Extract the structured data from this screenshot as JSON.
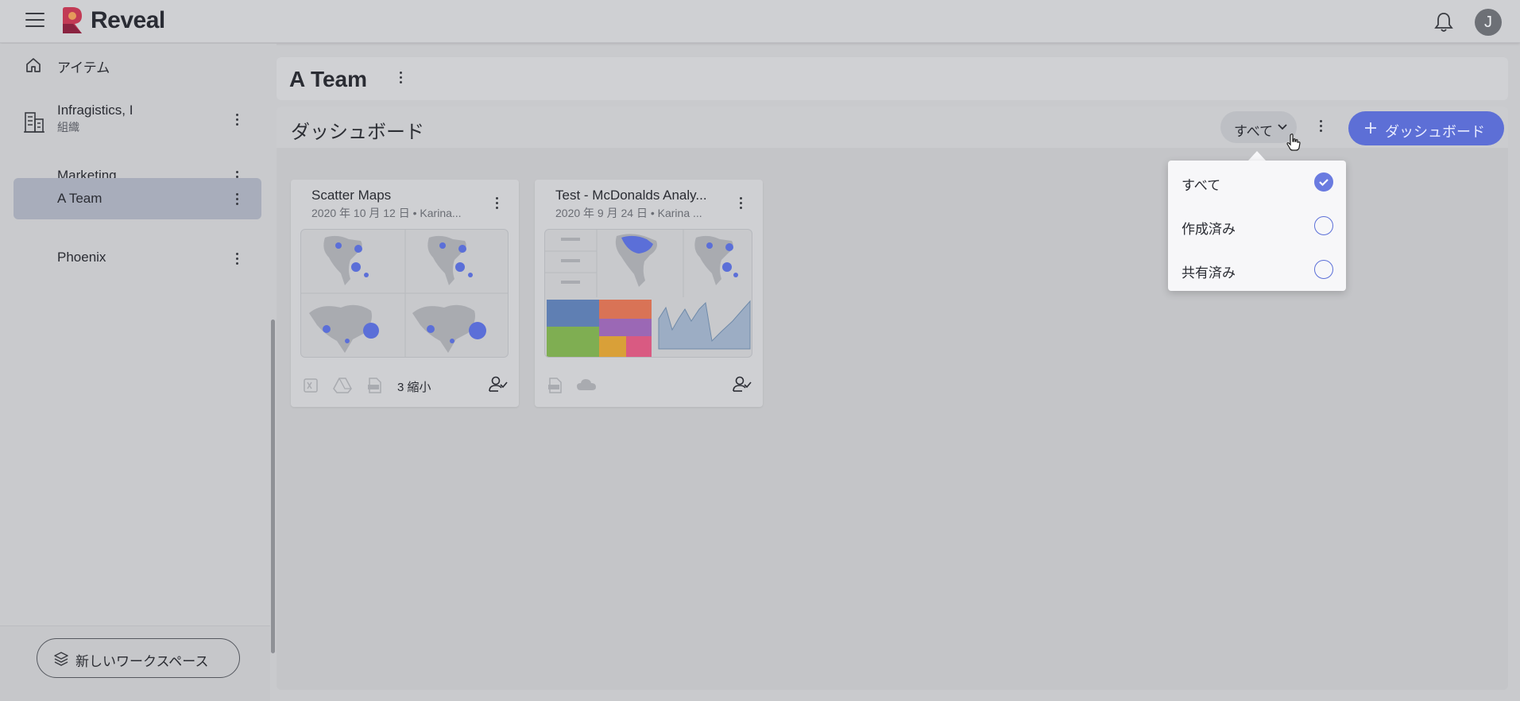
{
  "app": {
    "brand": "Reveal",
    "user_initial": "J",
    "accent_color": "#5d6fd6"
  },
  "sidebar": {
    "items": [
      {
        "label": "アイテム",
        "icon": "home-icon"
      },
      {
        "label": "Infragistics, I",
        "sub": "組織",
        "icon": "building-icon"
      },
      {
        "label": "Marketing"
      },
      {
        "label": "A Team",
        "active": true
      },
      {
        "label": "Phoenix"
      }
    ],
    "new_workspace_label": "新しいワークスペース"
  },
  "page": {
    "title": "A Team"
  },
  "section": {
    "title": "ダッシュボード",
    "filter_label": "すべて",
    "add_button_label": "ダッシュボード"
  },
  "cards": [
    {
      "title": "Scatter Maps",
      "subtitle": "2020 年 10 月 12 日 • Karina...",
      "footer_text": "3 縮小"
    },
    {
      "title": "Test - McDonalds Analy...",
      "subtitle": "2020 年 9 月 24 日 • Karina ..."
    }
  ],
  "dropdown": {
    "options": [
      {
        "label": "すべて",
        "selected": true
      },
      {
        "label": "作成済み",
        "selected": false
      },
      {
        "label": "共有済み",
        "selected": false
      }
    ]
  }
}
